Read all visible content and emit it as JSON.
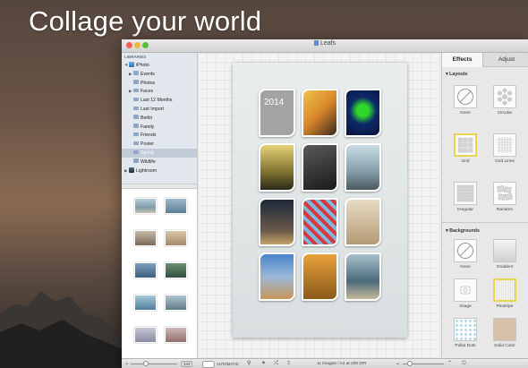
{
  "hero": {
    "title": "Collage your world"
  },
  "window": {
    "title": "Leafs"
  },
  "libraries": {
    "header": "LIBRARIES",
    "items": [
      {
        "label": "iPhoto",
        "level": 0,
        "arrow": "▼",
        "icon": "iphoto-icon"
      },
      {
        "label": "Events",
        "level": 1,
        "arrow": "▶",
        "icon": "folder-icon"
      },
      {
        "label": "Photos",
        "level": 1,
        "arrow": "",
        "icon": "folder-icon"
      },
      {
        "label": "Faces",
        "level": 1,
        "arrow": "▶",
        "icon": "folder-icon"
      },
      {
        "label": "Last 12 Months",
        "level": 1,
        "arrow": "",
        "icon": "folder-icon"
      },
      {
        "label": "Last Import",
        "level": 1,
        "arrow": "",
        "icon": "folder-icon"
      },
      {
        "label": "Berlin",
        "level": 1,
        "arrow": "",
        "icon": "folder-icon"
      },
      {
        "label": "Family",
        "level": 1,
        "arrow": "",
        "icon": "folder-icon"
      },
      {
        "label": "Friends",
        "level": 1,
        "arrow": "",
        "icon": "folder-icon"
      },
      {
        "label": "Poster",
        "level": 1,
        "arrow": "",
        "icon": "folder-icon"
      },
      {
        "label": "Spring",
        "level": 1,
        "arrow": "",
        "icon": "folder-icon",
        "selected": true
      },
      {
        "label": "Wildlife",
        "level": 1,
        "arrow": "",
        "icon": "folder-icon"
      },
      {
        "label": "Lightroom",
        "level": 0,
        "arrow": "▶",
        "icon": "lightroom-icon"
      }
    ]
  },
  "collage": {
    "year_label": "2014"
  },
  "panel": {
    "tabs": {
      "effects": "Effects",
      "adjust": "Adjust"
    },
    "layouts_header": "Layouts",
    "layouts": [
      "None",
      "Circular",
      "Grid",
      "Grid Lines",
      "Irregular",
      "Random"
    ],
    "backgrounds_header": "Backgrounds",
    "backgrounds": [
      "None",
      "Gradient",
      "Image",
      "Pinstripe",
      "Polka Dots",
      "Solid Color"
    ]
  },
  "bottom": {
    "count_badge": "134",
    "auto_label": "AUTOMATIC",
    "status": "11 images / A4 at 200 DPI"
  },
  "colors": {
    "selection": "#ead34e",
    "accent": "#5b8ed6"
  }
}
